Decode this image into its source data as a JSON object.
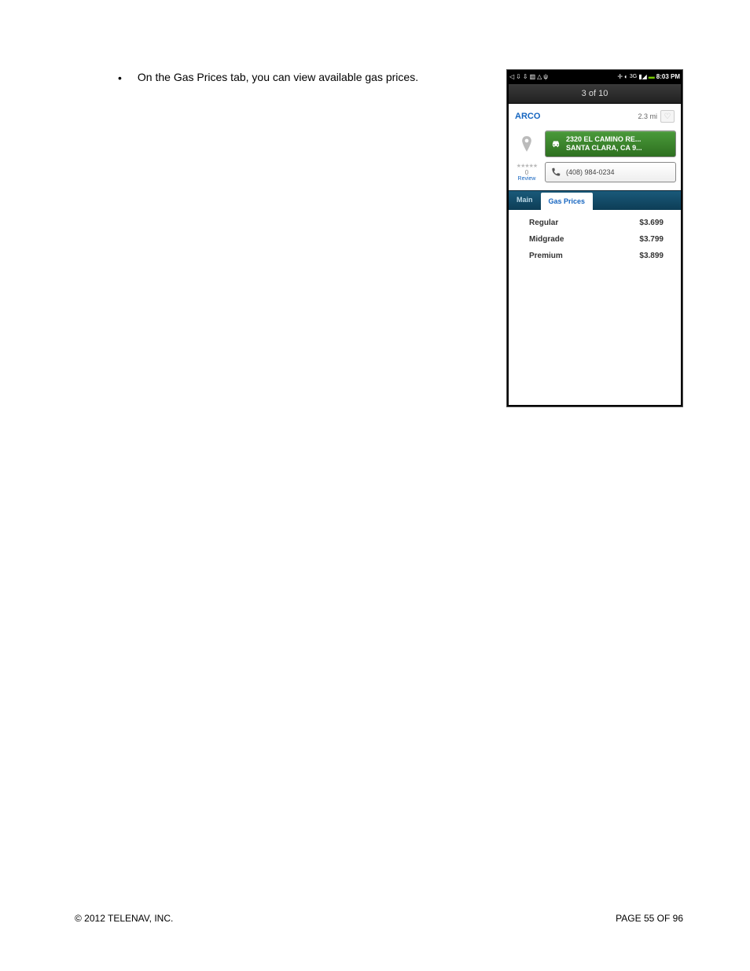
{
  "body_bullet": "On the Gas Prices tab, you can view available gas prices.",
  "status_bar": {
    "time": "8:03 PM"
  },
  "app": {
    "counter": "3 of 10",
    "poi_name": "ARCO",
    "distance": "2.3 mi",
    "address_line1": "2320 EL CAMINO RE...",
    "address_line2": "SANTA CLARA, CA 9...",
    "phone": "(408) 984-0234",
    "rating_count": "0",
    "rating_label": "Review",
    "tabs": {
      "main": "Main",
      "gas": "Gas Prices"
    },
    "prices": [
      {
        "grade": "Regular",
        "price": "$3.699"
      },
      {
        "grade": "Midgrade",
        "price": "$3.799"
      },
      {
        "grade": "Premium",
        "price": "$3.899"
      }
    ]
  },
  "footer": {
    "copyright": "© 2012 TELENAV, INC.",
    "page": "PAGE 55 OF 96"
  }
}
